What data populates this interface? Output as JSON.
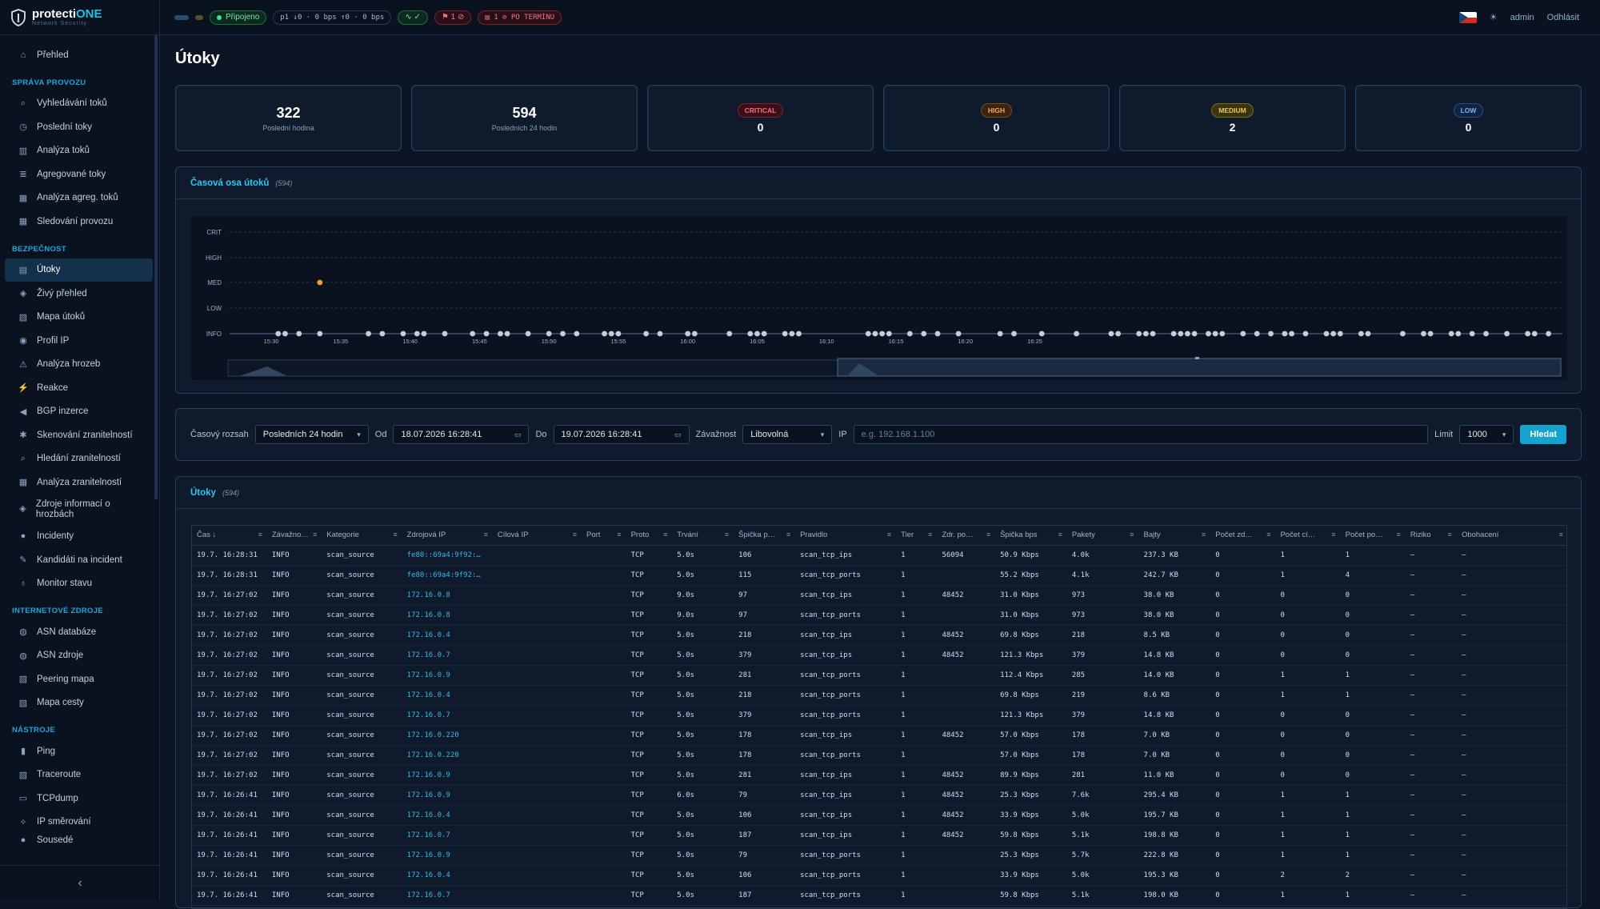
{
  "header": {
    "brand_main": "protecti",
    "brand_accent": "ONE",
    "brand_sub": "Network Security",
    "connected": "Připojeno",
    "traffic": "p1 ↓0 · 0 bps ↑0 · 0 bps",
    "alerts": "1",
    "overdue": "1 ⊘ PO TERMÍNU",
    "user": "admin",
    "logout": "Odhlásit"
  },
  "sidebar": {
    "overview": "Přehled",
    "sections": [
      {
        "title": "SPRÁVA PROVOZU",
        "items": [
          "Vyhledávání toků",
          "Poslední toky",
          "Analýza toků",
          "Agregované toky",
          "Analýza agreg. toků",
          "Sledování provozu"
        ]
      },
      {
        "title": "BEZPEČNOST",
        "items": [
          "Útoky",
          "Živý přehled",
          "Mapa útoků",
          "Profil IP",
          "Analýza hrozeb",
          "Reakce",
          "BGP inzerce",
          "Skenování zranitelností",
          "Hledání zranitelností",
          "Analýza zranitelností",
          "Zdroje informací o hrozbách",
          "Incidenty",
          "Kandidáti na incident",
          "Monitor stavu"
        ]
      },
      {
        "title": "INTERNETOVÉ ZDROJE",
        "items": [
          "ASN databáze",
          "ASN zdroje",
          "Peering mapa",
          "Mapa cesty"
        ]
      },
      {
        "title": "NÁSTROJE",
        "items": [
          "Ping",
          "Traceroute",
          "TCPdump",
          "IP směrování",
          "Sousedé"
        ]
      }
    ]
  },
  "page": {
    "title": "Útoky"
  },
  "cards": [
    {
      "value": "322",
      "label": "Poslední hodina"
    },
    {
      "value": "594",
      "label": "Posledních 24 hodin"
    },
    {
      "badge": "CRITICAL",
      "value": "0"
    },
    {
      "badge": "HIGH",
      "value": "0"
    },
    {
      "badge": "MEDIUM",
      "value": "2"
    },
    {
      "badge": "LOW",
      "value": "0"
    }
  ],
  "timeline": {
    "title": "Časová osa útoků",
    "count": "(594)"
  },
  "chart_data": {
    "type": "scatter",
    "y_categories": [
      "CRIT",
      "HIGH",
      "MED",
      "LOW",
      "INFO"
    ],
    "x_ticks": [
      "15:30",
      "15:35",
      "15:40",
      "15:45",
      "15:50",
      "15:55",
      "16:00",
      "16:05",
      "16:10",
      "16:15",
      "16:20",
      "16:25"
    ],
    "x_minutes": [
      15.5,
      16,
      17,
      18.5,
      22,
      23,
      24.5,
      25.5,
      26,
      27.5,
      29.5,
      30.5,
      31.5,
      32,
      33.5,
      35,
      36,
      37,
      39,
      39.5,
      40,
      42,
      43,
      45,
      45.5,
      48,
      49.5,
      50,
      50.5,
      52,
      52.5,
      53,
      58,
      58.5,
      59,
      59.5,
      61,
      62,
      63,
      64.5,
      67.5,
      68.5,
      70.5,
      73,
      75.5,
      76,
      77.5,
      78,
      78.5,
      80,
      80.5,
      81,
      81.5,
      82.5,
      83,
      83.5,
      85,
      86,
      87,
      88,
      88.5,
      89.5,
      91,
      91.5,
      92,
      93.5,
      94,
      96.5,
      98,
      98.5,
      100,
      100.5,
      101.5,
      102.5,
      104,
      105.5,
      106,
      107
    ],
    "med_points": [
      18.5
    ],
    "ylabel": "",
    "xlabel": ""
  },
  "filters": {
    "range_label": "Časový rozsah",
    "range_value": "Posledních 24 hodin",
    "from_label": "Od",
    "from_value": "18.07.2026 16:28:41",
    "to_label": "Do",
    "to_value": "19.07.2026 16:28:41",
    "sev_label": "Závažnost",
    "sev_value": "Libovolná",
    "ip_label": "IP",
    "ip_placeholder": "e.g. 192.168.1.100",
    "limit_label": "Limit",
    "limit_value": "1000",
    "search": "Hledat"
  },
  "table": {
    "title": "Útoky",
    "count": "(594)",
    "columns": [
      "Čas",
      "Závažno…",
      "Kategorie",
      "Zdrojová IP",
      "Cílová IP",
      "Port",
      "Proto",
      "Trvání",
      "Špička p…",
      "Pravidlo",
      "Tier",
      "Zdr. po…",
      "Špička bps",
      "Pakety",
      "Bajty",
      "Počet zd…",
      "Počet cí…",
      "Počet po…",
      "Riziko",
      "Obohacení"
    ],
    "rows": [
      [
        "19.7. 16:28:31",
        "INFO",
        "scan_source",
        "fe80::69a4:9f92:…",
        "",
        "",
        "TCP",
        "5.0s",
        "106",
        "scan_tcp_ips",
        "1",
        "56094",
        "50.9 Kbps",
        "4.0k",
        "237.3 KB",
        "0",
        "1",
        "1",
        "—",
        "—"
      ],
      [
        "19.7. 16:28:31",
        "INFO",
        "scan_source",
        "fe80::69a4:9f92:…",
        "",
        "",
        "TCP",
        "5.0s",
        "115",
        "scan_tcp_ports",
        "1",
        "",
        "55.2 Kbps",
        "4.1k",
        "242.7 KB",
        "0",
        "1",
        "4",
        "—",
        "—"
      ],
      [
        "19.7. 16:27:02",
        "INFO",
        "scan_source",
        "172.16.0.8",
        "",
        "",
        "TCP",
        "9.0s",
        "97",
        "scan_tcp_ips",
        "1",
        "48452",
        "31.0 Kbps",
        "973",
        "38.0 KB",
        "0",
        "0",
        "0",
        "—",
        "—"
      ],
      [
        "19.7. 16:27:02",
        "INFO",
        "scan_source",
        "172.16.0.8",
        "",
        "",
        "TCP",
        "9.0s",
        "97",
        "scan_tcp_ports",
        "1",
        "",
        "31.0 Kbps",
        "973",
        "38.0 KB",
        "0",
        "0",
        "0",
        "—",
        "—"
      ],
      [
        "19.7. 16:27:02",
        "INFO",
        "scan_source",
        "172.16.0.4",
        "",
        "",
        "TCP",
        "5.0s",
        "218",
        "scan_tcp_ips",
        "1",
        "48452",
        "69.8 Kbps",
        "218",
        "8.5 KB",
        "0",
        "0",
        "0",
        "—",
        "—"
      ],
      [
        "19.7. 16:27:02",
        "INFO",
        "scan_source",
        "172.16.0.7",
        "",
        "",
        "TCP",
        "5.0s",
        "379",
        "scan_tcp_ips",
        "1",
        "48452",
        "121.3 Kbps",
        "379",
        "14.8 KB",
        "0",
        "0",
        "0",
        "—",
        "—"
      ],
      [
        "19.7. 16:27:02",
        "INFO",
        "scan_source",
        "172.16.0.9",
        "",
        "",
        "TCP",
        "5.0s",
        "281",
        "scan_tcp_ports",
        "1",
        "",
        "112.4 Kbps",
        "285",
        "14.0 KB",
        "0",
        "1",
        "1",
        "—",
        "—"
      ],
      [
        "19.7. 16:27:02",
        "INFO",
        "scan_source",
        "172.16.0.4",
        "",
        "",
        "TCP",
        "5.0s",
        "218",
        "scan_tcp_ports",
        "1",
        "",
        "69.8 Kbps",
        "219",
        "8.6 KB",
        "0",
        "1",
        "1",
        "—",
        "—"
      ],
      [
        "19.7. 16:27:02",
        "INFO",
        "scan_source",
        "172.16.0.7",
        "",
        "",
        "TCP",
        "5.0s",
        "379",
        "scan_tcp_ports",
        "1",
        "",
        "121.3 Kbps",
        "379",
        "14.8 KB",
        "0",
        "0",
        "0",
        "—",
        "—"
      ],
      [
        "19.7. 16:27:02",
        "INFO",
        "scan_source",
        "172.16.0.220",
        "",
        "",
        "TCP",
        "5.0s",
        "178",
        "scan_tcp_ips",
        "1",
        "48452",
        "57.0 Kbps",
        "178",
        "7.0 KB",
        "0",
        "0",
        "0",
        "—",
        "—"
      ],
      [
        "19.7. 16:27:02",
        "INFO",
        "scan_source",
        "172.16.0.220",
        "",
        "",
        "TCP",
        "5.0s",
        "178",
        "scan_tcp_ports",
        "1",
        "",
        "57.0 Kbps",
        "178",
        "7.0 KB",
        "0",
        "0",
        "0",
        "—",
        "—"
      ],
      [
        "19.7. 16:27:02",
        "INFO",
        "scan_source",
        "172.16.0.9",
        "",
        "",
        "TCP",
        "5.0s",
        "281",
        "scan_tcp_ips",
        "1",
        "48452",
        "89.9 Kbps",
        "281",
        "11.0 KB",
        "0",
        "0",
        "0",
        "—",
        "—"
      ],
      [
        "19.7. 16:26:41",
        "INFO",
        "scan_source",
        "172.16.0.9",
        "",
        "",
        "TCP",
        "6.0s",
        "79",
        "scan_tcp_ips",
        "1",
        "48452",
        "25.3 Kbps",
        "7.6k",
        "295.4 KB",
        "0",
        "1",
        "1",
        "—",
        "—"
      ],
      [
        "19.7. 16:26:41",
        "INFO",
        "scan_source",
        "172.16.0.4",
        "",
        "",
        "TCP",
        "5.0s",
        "106",
        "scan_tcp_ips",
        "1",
        "48452",
        "33.9 Kbps",
        "5.0k",
        "195.7 KB",
        "0",
        "1",
        "1",
        "—",
        "—"
      ],
      [
        "19.7. 16:26:41",
        "INFO",
        "scan_source",
        "172.16.0.7",
        "",
        "",
        "TCP",
        "5.0s",
        "187",
        "scan_tcp_ips",
        "1",
        "48452",
        "59.8 Kbps",
        "5.1k",
        "198.8 KB",
        "0",
        "1",
        "1",
        "—",
        "—"
      ],
      [
        "19.7. 16:26:41",
        "INFO",
        "scan_source",
        "172.16.0.9",
        "",
        "",
        "TCP",
        "5.0s",
        "79",
        "scan_tcp_ports",
        "1",
        "",
        "25.3 Kbps",
        "5.7k",
        "222.8 KB",
        "0",
        "1",
        "1",
        "—",
        "—"
      ],
      [
        "19.7. 16:26:41",
        "INFO",
        "scan_source",
        "172.16.0.4",
        "",
        "",
        "TCP",
        "5.0s",
        "106",
        "scan_tcp_ports",
        "1",
        "",
        "33.9 Kbps",
        "5.0k",
        "195.3 KB",
        "0",
        "2",
        "2",
        "—",
        "—"
      ],
      [
        "19.7. 16:26:41",
        "INFO",
        "scan_source",
        "172.16.0.7",
        "",
        "",
        "TCP",
        "5.0s",
        "187",
        "scan_tcp_ports",
        "1",
        "",
        "59.8 Kbps",
        "5.1k",
        "198.0 KB",
        "0",
        "1",
        "1",
        "—",
        "—"
      ]
    ]
  }
}
